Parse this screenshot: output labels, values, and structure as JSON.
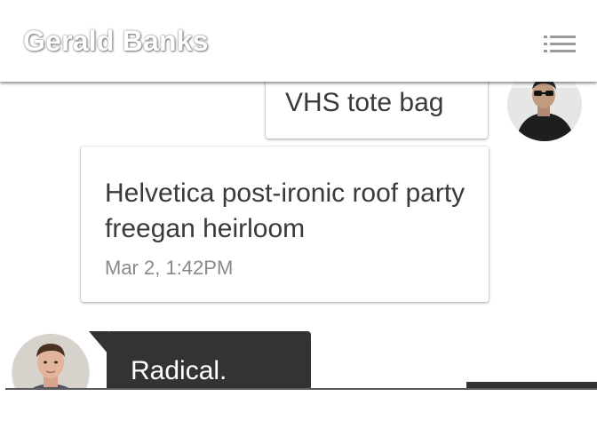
{
  "header": {
    "title": "Gerald Banks",
    "menu_icon": "hamburger-menu-icon"
  },
  "messages": [
    {
      "text": "VHS tote bag",
      "sender": "self"
    },
    {
      "text": "Helvetica post-ironic roof party freegan heirloom",
      "time": "Mar 2, 1:42PM",
      "sender": "self"
    },
    {
      "text": "Radical.",
      "sender": "other"
    }
  ],
  "colors": {
    "header_bg": "#ffffff",
    "dark_bubble": "#333333",
    "timestamp": "#8a8a8a",
    "card_text": "#3a3a3a"
  }
}
